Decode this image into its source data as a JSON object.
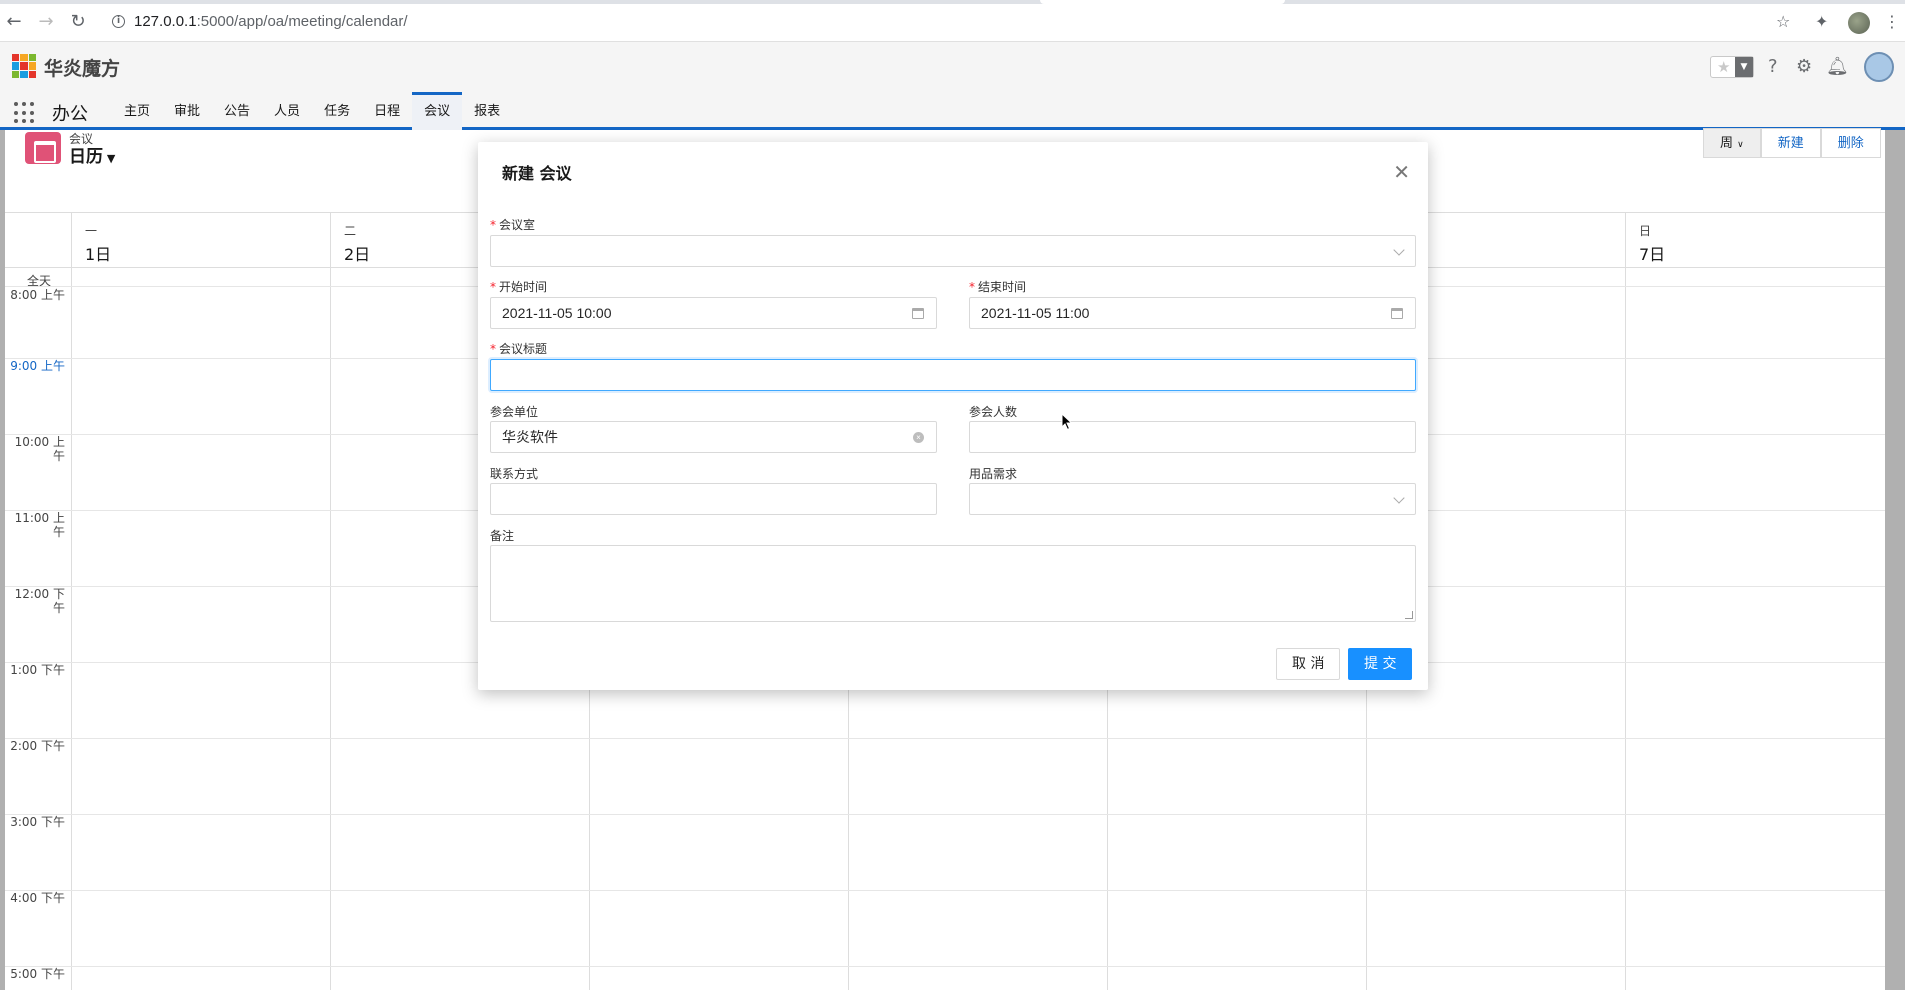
{
  "browser": {
    "url_host": "127.0.0.1",
    "url_rest": ":5000/app/oa/meeting/calendar/"
  },
  "app": {
    "brand": "华炎魔方",
    "app_name": "办公",
    "nav": [
      "主页",
      "审批",
      "公告",
      "人员",
      "任务",
      "日程",
      "会议",
      "报表"
    ],
    "active_nav": "会议"
  },
  "calendar": {
    "object_label": "会议",
    "view_name": "日历",
    "view_toggle": "周",
    "new_button": "新建",
    "delete_button": "删除",
    "days": [
      {
        "weekday": "一",
        "date": "1日"
      },
      {
        "weekday": "二",
        "date": "2日"
      },
      {
        "weekday": "",
        "date": ""
      },
      {
        "weekday": "",
        "date": ""
      },
      {
        "weekday": "",
        "date": ""
      },
      {
        "weekday": "",
        "date": ""
      },
      {
        "weekday": "日",
        "date": "7日"
      }
    ],
    "all_day": "全天",
    "hours": [
      "8:00 上午",
      "9:00 上午",
      "10:00 上午",
      "11:00 上午",
      "12:00 下午",
      "1:00 下午",
      "2:00 下午",
      "3:00 下午",
      "4:00 下午",
      "5:00 下午"
    ]
  },
  "modal": {
    "title": "新建 会议",
    "fields": {
      "room": {
        "label": "会议室",
        "value": ""
      },
      "start": {
        "label": "开始时间",
        "value": "2021-11-05 10:00"
      },
      "end": {
        "label": "结束时间",
        "value": "2021-11-05 11:00"
      },
      "subject": {
        "label": "会议标题",
        "value": ""
      },
      "unit": {
        "label": "参会单位",
        "value": "华炎软件"
      },
      "count": {
        "label": "参会人数",
        "value": ""
      },
      "contact": {
        "label": "联系方式",
        "value": ""
      },
      "supplies": {
        "label": "用品需求",
        "value": ""
      },
      "remark": {
        "label": "备注",
        "value": ""
      }
    },
    "cancel": "取 消",
    "submit": "提 交"
  }
}
